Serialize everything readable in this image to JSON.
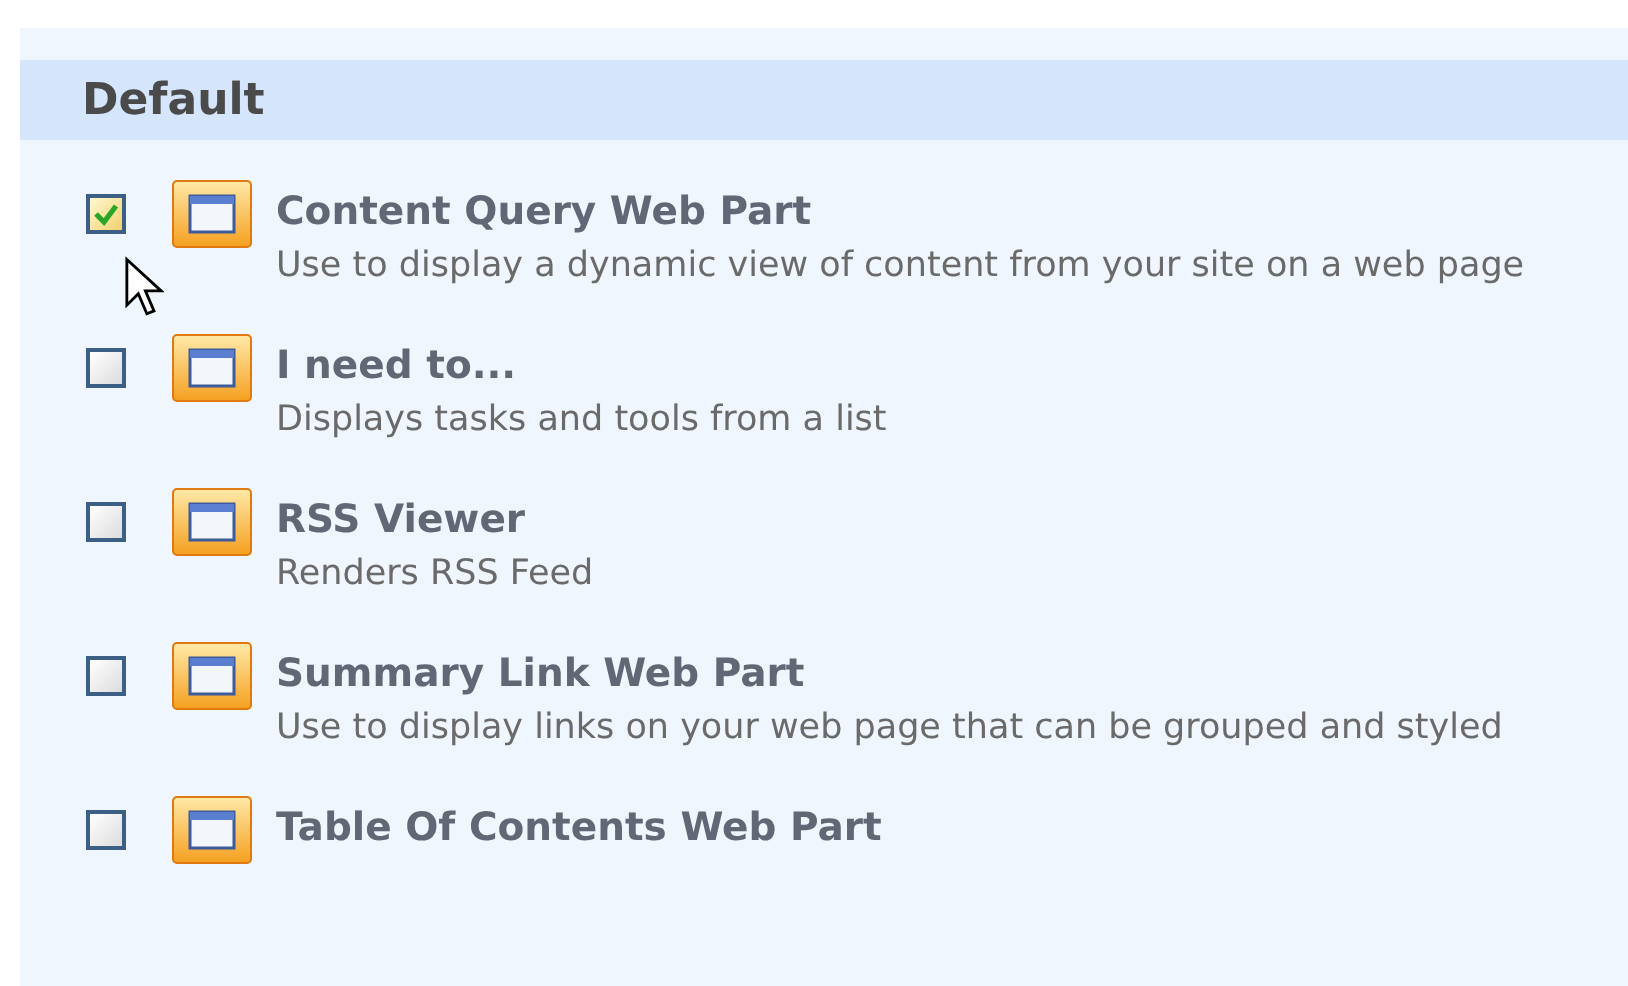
{
  "section": {
    "title": "Default"
  },
  "items": [
    {
      "title": "Content Query Web Part",
      "description": "Use to display a dynamic view of content from your site on a web page",
      "checked": true
    },
    {
      "title": "I need to...",
      "description": "Displays tasks and tools from a list",
      "checked": false
    },
    {
      "title": "RSS Viewer",
      "description": "Renders RSS Feed",
      "checked": false
    },
    {
      "title": "Summary Link Web Part",
      "description": "Use to display links on your web page that can be grouped and styled",
      "checked": false
    },
    {
      "title": "Table Of Contents Web Part",
      "checked": false
    }
  ]
}
